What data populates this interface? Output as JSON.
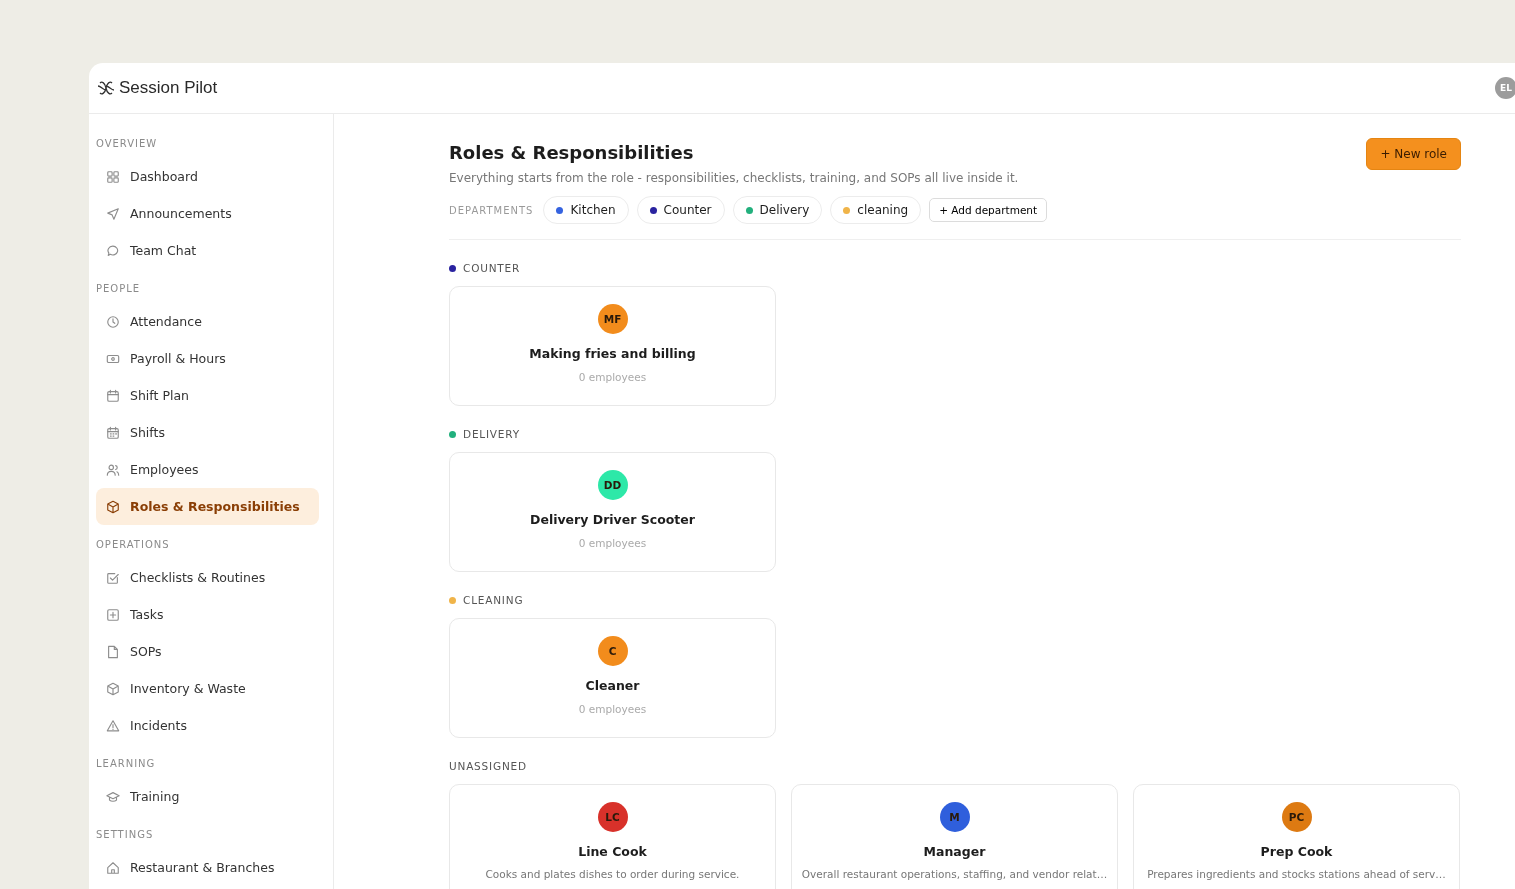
{
  "app": {
    "name": "Session Pilot",
    "user_initials": "EL"
  },
  "sidebar": {
    "sections": [
      {
        "heading": "OVERVIEW",
        "items": [
          {
            "label": "Dashboard",
            "selected": false
          },
          {
            "label": "Announcements",
            "selected": false
          },
          {
            "label": "Team Chat",
            "selected": false
          }
        ]
      },
      {
        "heading": "PEOPLE",
        "items": [
          {
            "label": "Attendance",
            "selected": false
          },
          {
            "label": "Payroll & Hours",
            "selected": false
          },
          {
            "label": "Shift Plan",
            "selected": false
          },
          {
            "label": "Shifts",
            "selected": false
          },
          {
            "label": "Employees",
            "selected": false
          },
          {
            "label": "Roles & Responsibilities",
            "selected": true
          }
        ]
      },
      {
        "heading": "OPERATIONS",
        "items": [
          {
            "label": "Checklists & Routines",
            "selected": false
          },
          {
            "label": "Tasks",
            "selected": false
          },
          {
            "label": "SOPs",
            "selected": false
          },
          {
            "label": "Inventory & Waste",
            "selected": false
          },
          {
            "label": "Incidents",
            "selected": false
          }
        ]
      },
      {
        "heading": "LEARNING",
        "items": [
          {
            "label": "Training",
            "selected": false
          }
        ]
      },
      {
        "heading": "SETTINGS",
        "items": [
          {
            "label": "Restaurant & Branches",
            "selected": false
          }
        ]
      }
    ]
  },
  "page": {
    "title": "Roles & Responsibilities",
    "subtitle": "Everything starts from the role - responsibilities, checklists, training, and SOPs all live inside it.",
    "new_button": "+ New role",
    "departments_label": "DEPARTMENTS",
    "departments": [
      {
        "name": "Kitchen",
        "color": "#3563e0"
      },
      {
        "name": "Counter",
        "color": "#2a23a0"
      },
      {
        "name": "Delivery",
        "color": "#22b07d"
      },
      {
        "name": "cleaning",
        "color": "#f0b449"
      }
    ],
    "add_department": "+ Add department"
  },
  "groups": [
    {
      "name": "COUNTER",
      "color": "#2a23a0",
      "roles": [
        {
          "initials": "MF",
          "color": "#f28c1c",
          "title": "Making fries and billing",
          "detail": "0 employees",
          "kind": "count"
        }
      ]
    },
    {
      "name": "DELIVERY",
      "color": "#22b07d",
      "roles": [
        {
          "initials": "DD",
          "color": "#2de8a8",
          "title": "Delivery Driver Scooter",
          "detail": "0 employees",
          "kind": "count"
        }
      ]
    },
    {
      "name": "CLEANING",
      "color": "#f0b449",
      "roles": [
        {
          "initials": "C",
          "color": "#f28c1c",
          "title": "Cleaner",
          "detail": "0 employees",
          "kind": "count"
        }
      ]
    },
    {
      "name": "UNASSIGNED",
      "roles": [
        {
          "initials": "LC",
          "color": "#d8312a",
          "title": "Line Cook",
          "detail": "Cooks and plates dishes to order during service.",
          "kind": "description"
        },
        {
          "initials": "M",
          "color": "#2f5fdc",
          "title": "Manager",
          "detail": "Overall restaurant operations, staffing, and vendor relat…",
          "kind": "description"
        },
        {
          "initials": "PC",
          "color": "#dd7a12",
          "title": "Prep Cook",
          "detail": "Prepares ingredients and stocks stations ahead of serv…",
          "kind": "description"
        }
      ]
    }
  ]
}
